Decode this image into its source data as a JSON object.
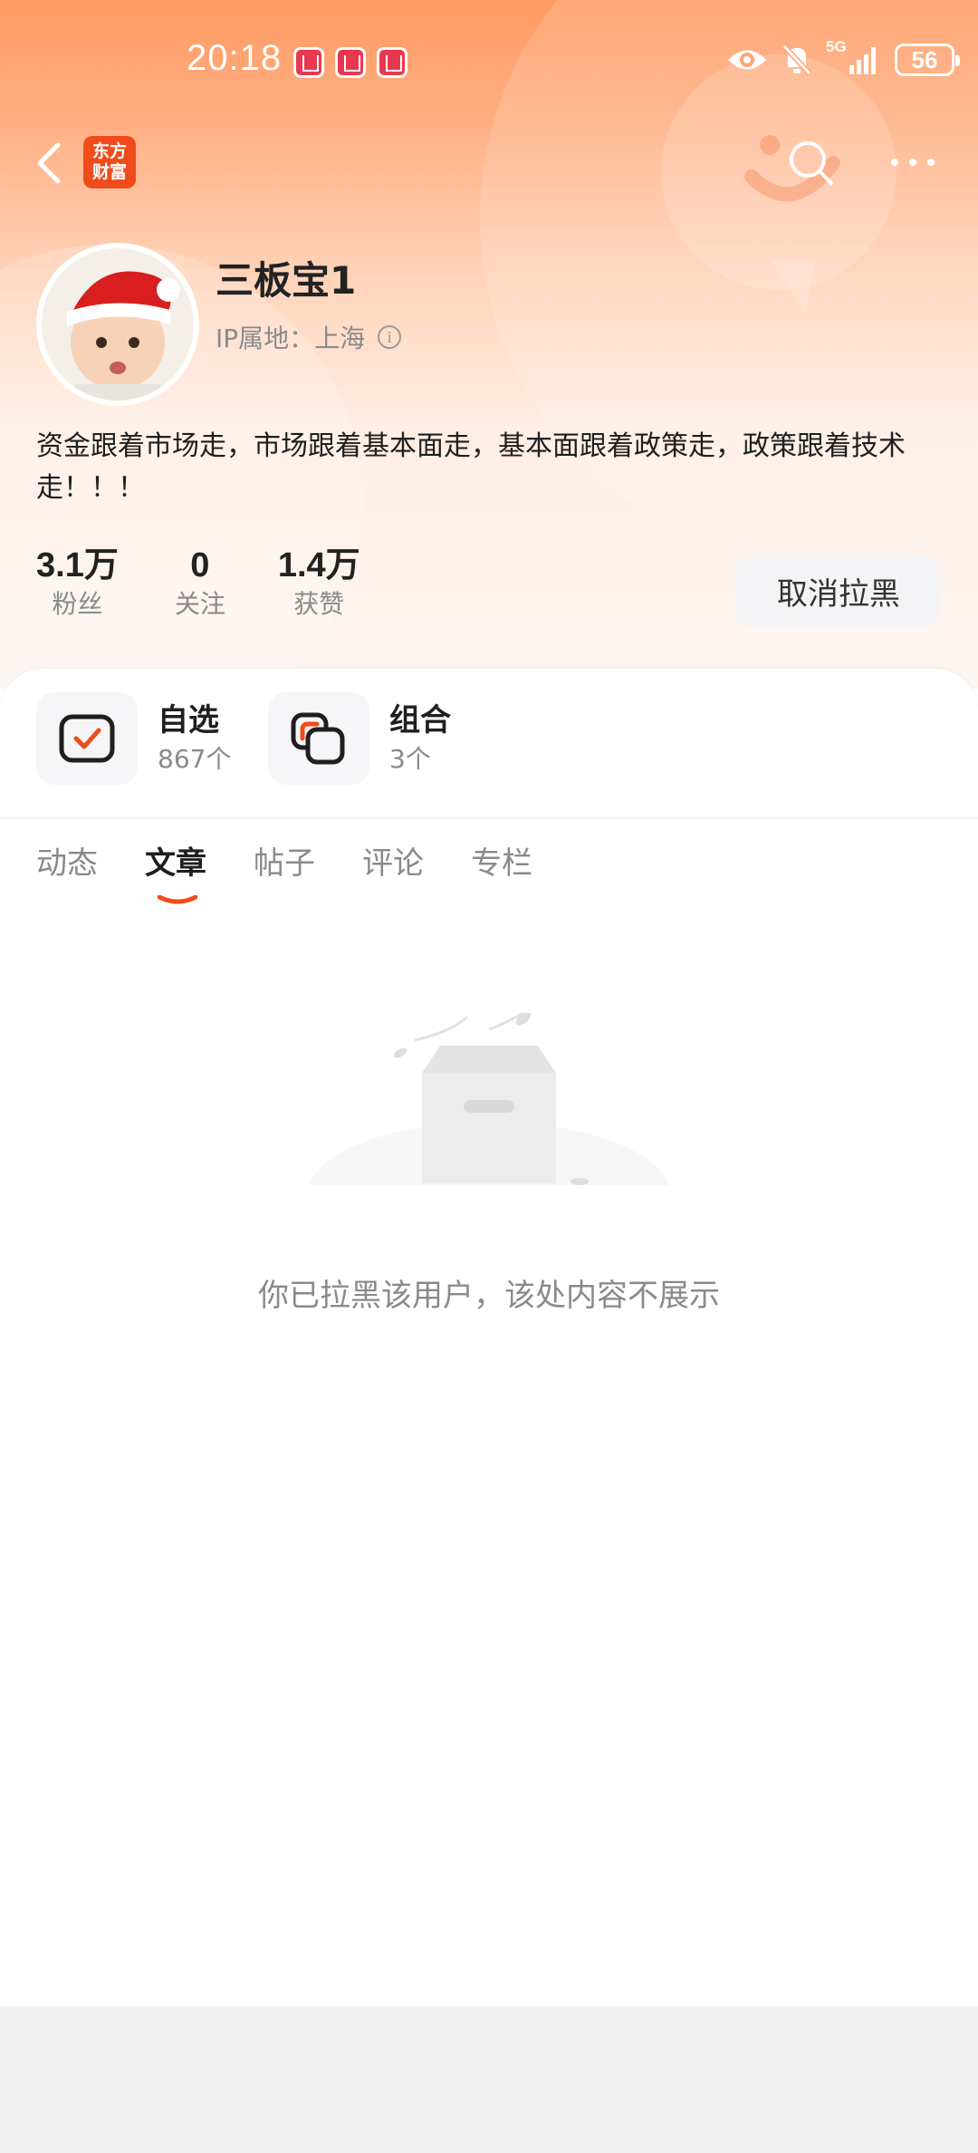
{
  "status_bar": {
    "time": "20:18",
    "network": "5G",
    "battery": "56"
  },
  "nav": {
    "logo_line1": "东方",
    "logo_line2": "财富"
  },
  "profile": {
    "username": "三板宝1",
    "ip_location": "IP属地：上海",
    "bio": "资金跟着市场走，市场跟着基本面走，基本面跟着政策走，政策跟着技术走！！！",
    "stats": [
      {
        "value": "3.1万",
        "label": "粉丝"
      },
      {
        "value": "0",
        "label": "关注"
      },
      {
        "value": "1.4万",
        "label": "获赞"
      }
    ],
    "unblock_label": "取消拉黑"
  },
  "shortcuts": [
    {
      "title": "自选",
      "count": "867个",
      "icon": "checkbox-icon"
    },
    {
      "title": "组合",
      "count": "3个",
      "icon": "portfolio-icon"
    }
  ],
  "tabs": [
    {
      "label": "动态"
    },
    {
      "label": "文章"
    },
    {
      "label": "帖子"
    },
    {
      "label": "评论"
    },
    {
      "label": "专栏"
    }
  ],
  "active_tab": "文章",
  "empty_state": {
    "message": "你已拉黑该用户，该处内容不展示"
  },
  "colors": {
    "accent": "#f04b1a",
    "header_gradient_top": "#ff9a63"
  }
}
